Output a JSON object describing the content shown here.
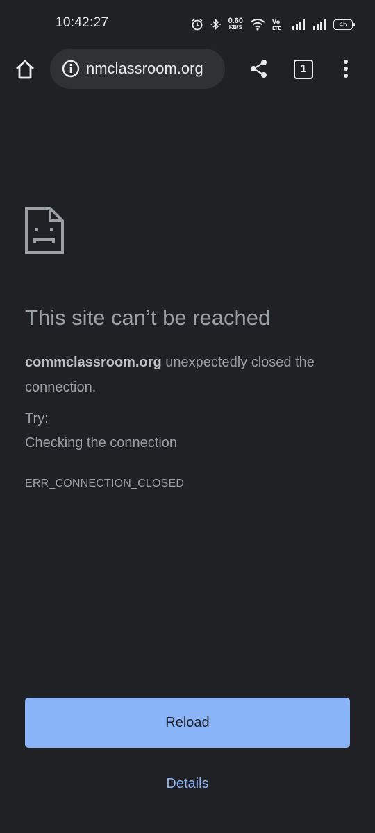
{
  "status_bar": {
    "time": "10:42:27",
    "net_speed_value": "0.60",
    "net_speed_unit": "KB/S",
    "volte_label": "Vo LTE2",
    "battery": "45"
  },
  "toolbar": {
    "url": "nmclassroom.org",
    "tab_count": "1"
  },
  "error_page": {
    "title": "This site can’t be reached",
    "host": "commclassroom.org",
    "message_rest": " unexpectedly closed the connection.",
    "try_label": "Try:",
    "try_items": [
      "Checking the connection"
    ],
    "error_code": "ERR_CONNECTION_CLOSED",
    "reload_label": "Reload",
    "details_label": "Details"
  },
  "colors": {
    "background": "#202124",
    "accent": "#8ab4f8",
    "text": "#9aa0a6"
  }
}
